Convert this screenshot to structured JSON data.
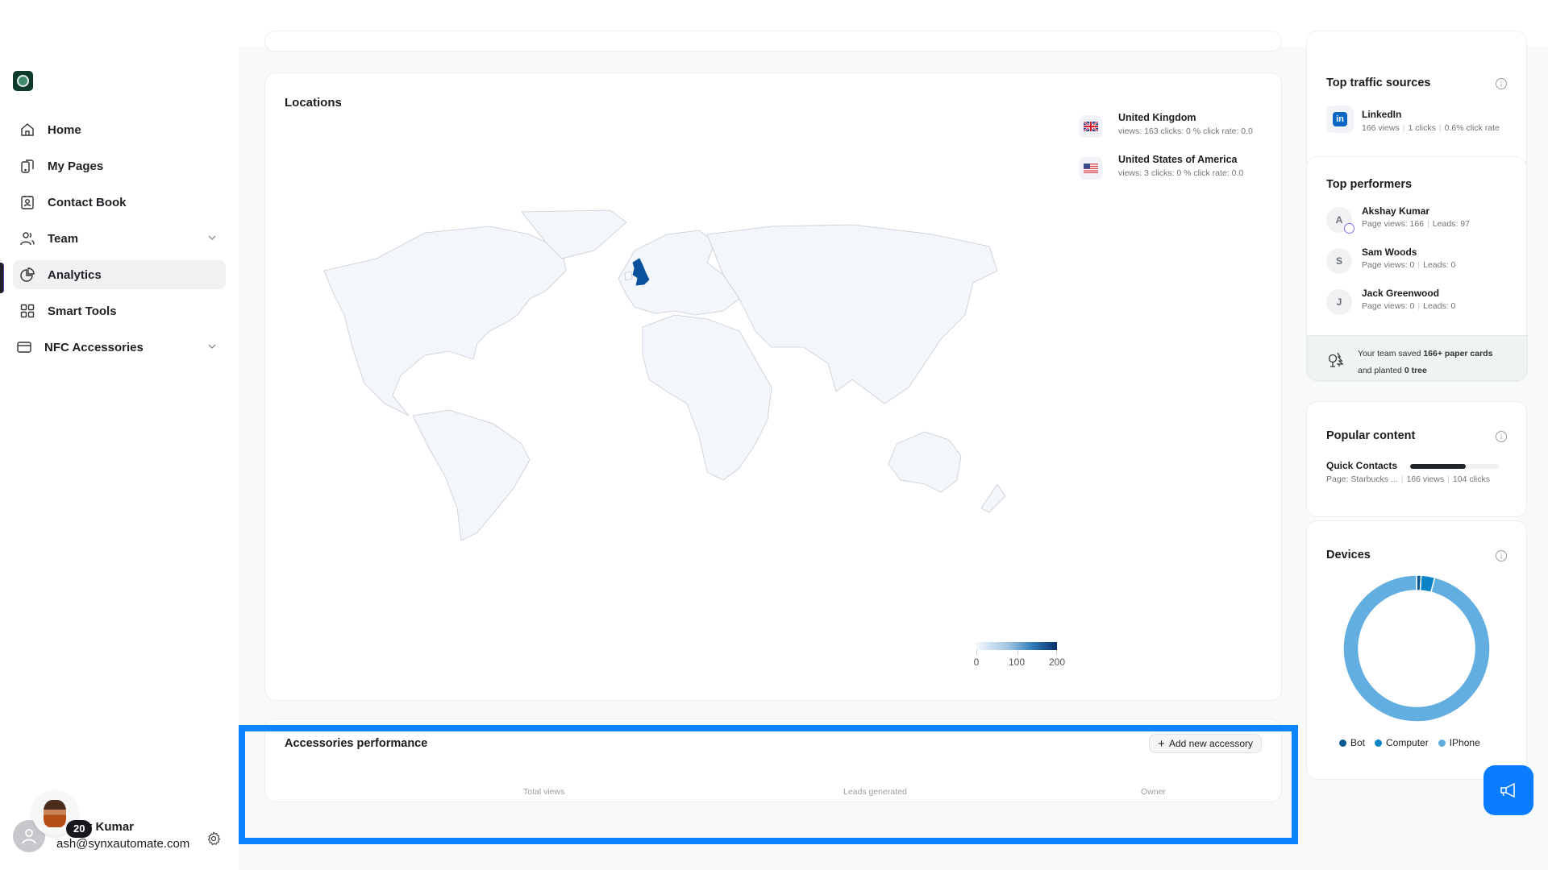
{
  "sidebar": {
    "logo": "starbucks-logo",
    "items": [
      {
        "label": "Home",
        "icon": "home-icon",
        "active": false,
        "expandable": false
      },
      {
        "label": "My Pages",
        "icon": "pages-icon",
        "active": false,
        "expandable": false
      },
      {
        "label": "Contact Book",
        "icon": "contact-book-icon",
        "active": false,
        "expandable": false
      },
      {
        "label": "Team",
        "icon": "team-icon",
        "active": false,
        "expandable": true
      },
      {
        "label": "Analytics",
        "icon": "pie-chart-icon",
        "active": true,
        "expandable": false
      },
      {
        "label": "Smart Tools",
        "icon": "grid-icon",
        "active": false,
        "expandable": false
      },
      {
        "label": "NFC Accessories",
        "icon": "card-icon",
        "active": false,
        "expandable": true
      }
    ],
    "user": {
      "badge_count": "20",
      "name_visible": "y Kumar",
      "email": "ash@synxautomate.com"
    }
  },
  "locations": {
    "title": "Locations",
    "countries": [
      {
        "name": "United Kingdom",
        "flag": "uk-flag-icon",
        "stats": "views: 163 clicks: 0 % click rate: 0.0",
        "views": 163
      },
      {
        "name": "United States of America",
        "flag": "us-flag-icon",
        "stats": "views: 3 clicks: 0 % click rate: 0.0",
        "views": 3
      }
    ],
    "scale": {
      "min": "0",
      "mid": "100",
      "max": "200"
    },
    "colors": {
      "low": "#f4f8fd",
      "high": "#08306b",
      "highlight": "#08519c"
    }
  },
  "accessories": {
    "title": "Accessories performance",
    "add_button": "Add new accessory",
    "columns": [
      "Total views",
      "Leads generated",
      "Owner"
    ]
  },
  "traffic": {
    "title": "Top traffic sources",
    "sources": [
      {
        "name": "LinkedIn",
        "views": "166 views",
        "clicks": "1 clicks",
        "rate": "0.6% click rate"
      }
    ]
  },
  "performers": {
    "title": "Top performers",
    "people": [
      {
        "initial": "A",
        "name": "Akshay Kumar",
        "views": "Page views: 166",
        "leads": "Leads: 97",
        "crown": true
      },
      {
        "initial": "S",
        "name": "Sam Woods",
        "views": "Page views: 0",
        "leads": "Leads: 0",
        "crown": false
      },
      {
        "initial": "J",
        "name": "Jack Greenwood",
        "views": "Page views: 0",
        "leads": "Leads: 0",
        "crown": false
      }
    ],
    "eco": {
      "pre": "Your team saved ",
      "bold1": "166+ paper cards",
      "mid": "and planted ",
      "bold2": "0 tree"
    }
  },
  "popular": {
    "title": "Popular content",
    "items": [
      {
        "name": "Quick Contacts",
        "page": "Page: Starbucks ...",
        "views": "166 views",
        "clicks": "104 clicks",
        "fraction": 0.63
      }
    ]
  },
  "devices": {
    "title": "Devices",
    "chart_data": {
      "type": "pie",
      "variant": "donut",
      "categories": [
        "Bot",
        "Computer",
        "IPhone"
      ],
      "values": [
        1,
        3,
        96
      ],
      "colors": [
        "#0b5a8f",
        "#0a84c6",
        "#62aee0"
      ],
      "legend": "bottom"
    }
  },
  "fab": {
    "icon": "megaphone-icon"
  }
}
